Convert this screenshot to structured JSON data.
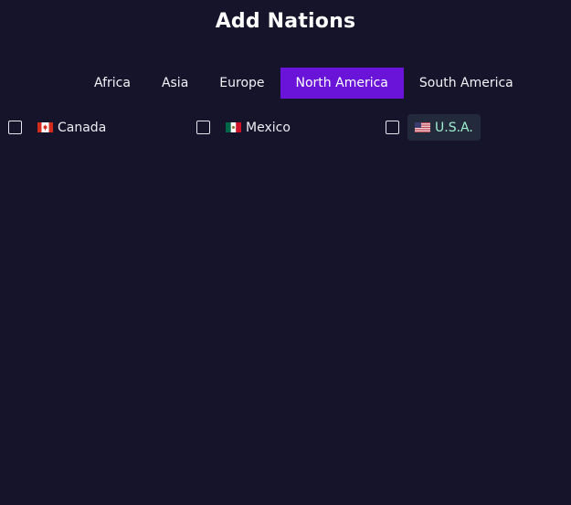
{
  "title": "Add Nations",
  "tabs": [
    {
      "label": "Africa",
      "active": false
    },
    {
      "label": "Asia",
      "active": false
    },
    {
      "label": "Europe",
      "active": false
    },
    {
      "label": "North America",
      "active": true
    },
    {
      "label": "South America",
      "active": false
    }
  ],
  "nations": [
    {
      "name": "Canada",
      "checked": false,
      "flag_icon": "canada-flag-icon"
    },
    {
      "name": "Mexico",
      "checked": false,
      "flag_icon": "mexico-flag-icon"
    },
    {
      "name": "U.S.A.",
      "checked": false,
      "flag_icon": "usa-flag-icon",
      "highlighted": true
    }
  ],
  "colors": {
    "background": "#15142b",
    "active_tab": "#6a14d9",
    "highlight_chip_bg": "#232a3b",
    "highlight_chip_text": "#9ff0d0"
  }
}
